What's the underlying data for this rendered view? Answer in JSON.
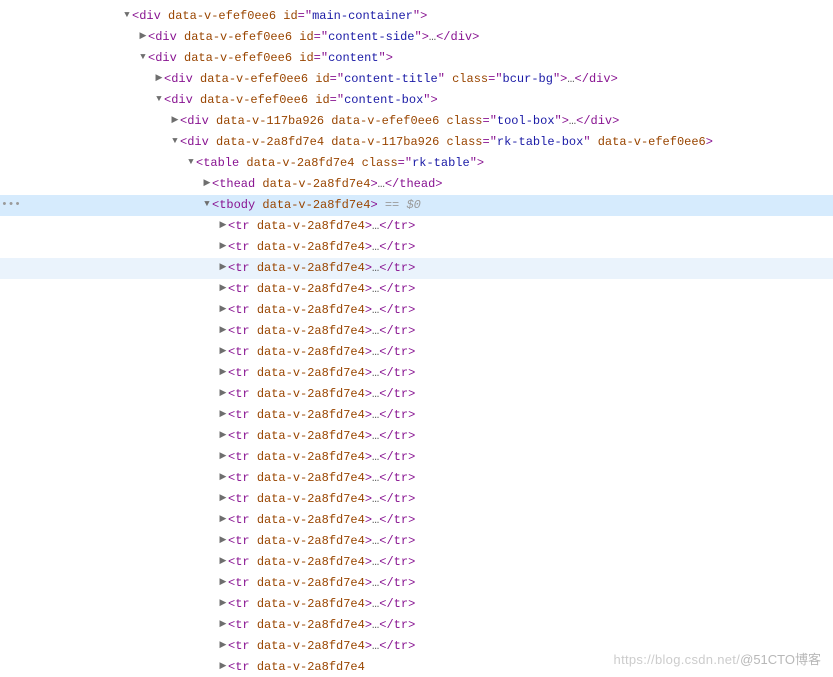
{
  "indentStep": 16,
  "baseIndent": 100,
  "selectedIndex": 8,
  "hoveredIndex": 11,
  "gutterMarkIndex": 8,
  "gutterMark": "•••",
  "console_ref": " == $0",
  "watermark": {
    "left": "https://blog.csdn.net/",
    "right": "@51CTO博客"
  },
  "nodes": [
    {
      "depth": 0,
      "arrow": "down",
      "kind": "open",
      "tag": "div",
      "attrs": [
        [
          "data-v-efef0ee6",
          null
        ],
        [
          "id",
          "main-container"
        ]
      ]
    },
    {
      "depth": 1,
      "arrow": "right",
      "kind": "collapsed",
      "tag": "div",
      "attrs": [
        [
          "data-v-efef0ee6",
          null
        ],
        [
          "id",
          "content-side"
        ]
      ]
    },
    {
      "depth": 1,
      "arrow": "down",
      "kind": "open",
      "tag": "div",
      "attrs": [
        [
          "data-v-efef0ee6",
          null
        ],
        [
          "id",
          "content"
        ]
      ]
    },
    {
      "depth": 2,
      "arrow": "right",
      "kind": "collapsed",
      "tag": "div",
      "attrs": [
        [
          "data-v-efef0ee6",
          null
        ],
        [
          "id",
          "content-title"
        ],
        [
          "class",
          "bcur-bg"
        ]
      ]
    },
    {
      "depth": 2,
      "arrow": "down",
      "kind": "open",
      "tag": "div",
      "attrs": [
        [
          "data-v-efef0ee6",
          null
        ],
        [
          "id",
          "content-box"
        ]
      ]
    },
    {
      "depth": 3,
      "arrow": "right",
      "kind": "collapsed",
      "tag": "div",
      "attrs": [
        [
          "data-v-117ba926",
          null
        ],
        [
          "data-v-efef0ee6",
          null
        ],
        [
          "class",
          "tool-box"
        ]
      ]
    },
    {
      "depth": 3,
      "arrow": "down",
      "kind": "open",
      "tag": "div",
      "attrs": [
        [
          "data-v-2a8fd7e4",
          null
        ],
        [
          "data-v-117ba926",
          null
        ],
        [
          "class",
          "rk-table-box"
        ],
        [
          "data-v-efef0ee6",
          null
        ]
      ]
    },
    {
      "depth": 4,
      "arrow": "down",
      "kind": "open",
      "tag": "table",
      "attrs": [
        [
          "data-v-2a8fd7e4",
          null
        ],
        [
          "class",
          "rk-table"
        ]
      ]
    },
    {
      "depth": 5,
      "arrow": "right",
      "kind": "collapsed",
      "tag": "thead",
      "attrs": [
        [
          "data-v-2a8fd7e4",
          null
        ]
      ]
    },
    {
      "depth": 5,
      "arrow": "down",
      "kind": "open",
      "tag": "tbody",
      "attrs": [
        [
          "data-v-2a8fd7e4",
          null
        ]
      ],
      "consoleRef": true
    },
    {
      "depth": 6,
      "arrow": "right",
      "kind": "collapsed",
      "tag": "tr",
      "attrs": [
        [
          "data-v-2a8fd7e4",
          null
        ]
      ]
    },
    {
      "depth": 6,
      "arrow": "right",
      "kind": "collapsed",
      "tag": "tr",
      "attrs": [
        [
          "data-v-2a8fd7e4",
          null
        ]
      ]
    },
    {
      "depth": 6,
      "arrow": "right",
      "kind": "collapsed",
      "tag": "tr",
      "attrs": [
        [
          "data-v-2a8fd7e4",
          null
        ]
      ]
    },
    {
      "depth": 6,
      "arrow": "right",
      "kind": "collapsed",
      "tag": "tr",
      "attrs": [
        [
          "data-v-2a8fd7e4",
          null
        ]
      ]
    },
    {
      "depth": 6,
      "arrow": "right",
      "kind": "collapsed",
      "tag": "tr",
      "attrs": [
        [
          "data-v-2a8fd7e4",
          null
        ]
      ]
    },
    {
      "depth": 6,
      "arrow": "right",
      "kind": "collapsed",
      "tag": "tr",
      "attrs": [
        [
          "data-v-2a8fd7e4",
          null
        ]
      ]
    },
    {
      "depth": 6,
      "arrow": "right",
      "kind": "collapsed",
      "tag": "tr",
      "attrs": [
        [
          "data-v-2a8fd7e4",
          null
        ]
      ]
    },
    {
      "depth": 6,
      "arrow": "right",
      "kind": "collapsed",
      "tag": "tr",
      "attrs": [
        [
          "data-v-2a8fd7e4",
          null
        ]
      ]
    },
    {
      "depth": 6,
      "arrow": "right",
      "kind": "collapsed",
      "tag": "tr",
      "attrs": [
        [
          "data-v-2a8fd7e4",
          null
        ]
      ]
    },
    {
      "depth": 6,
      "arrow": "right",
      "kind": "collapsed",
      "tag": "tr",
      "attrs": [
        [
          "data-v-2a8fd7e4",
          null
        ]
      ]
    },
    {
      "depth": 6,
      "arrow": "right",
      "kind": "collapsed",
      "tag": "tr",
      "attrs": [
        [
          "data-v-2a8fd7e4",
          null
        ]
      ]
    },
    {
      "depth": 6,
      "arrow": "right",
      "kind": "collapsed",
      "tag": "tr",
      "attrs": [
        [
          "data-v-2a8fd7e4",
          null
        ]
      ]
    },
    {
      "depth": 6,
      "arrow": "right",
      "kind": "collapsed",
      "tag": "tr",
      "attrs": [
        [
          "data-v-2a8fd7e4",
          null
        ]
      ]
    },
    {
      "depth": 6,
      "arrow": "right",
      "kind": "collapsed",
      "tag": "tr",
      "attrs": [
        [
          "data-v-2a8fd7e4",
          null
        ]
      ]
    },
    {
      "depth": 6,
      "arrow": "right",
      "kind": "collapsed",
      "tag": "tr",
      "attrs": [
        [
          "data-v-2a8fd7e4",
          null
        ]
      ]
    },
    {
      "depth": 6,
      "arrow": "right",
      "kind": "collapsed",
      "tag": "tr",
      "attrs": [
        [
          "data-v-2a8fd7e4",
          null
        ]
      ]
    },
    {
      "depth": 6,
      "arrow": "right",
      "kind": "collapsed",
      "tag": "tr",
      "attrs": [
        [
          "data-v-2a8fd7e4",
          null
        ]
      ]
    },
    {
      "depth": 6,
      "arrow": "right",
      "kind": "collapsed",
      "tag": "tr",
      "attrs": [
        [
          "data-v-2a8fd7e4",
          null
        ]
      ]
    },
    {
      "depth": 6,
      "arrow": "right",
      "kind": "collapsed",
      "tag": "tr",
      "attrs": [
        [
          "data-v-2a8fd7e4",
          null
        ]
      ]
    },
    {
      "depth": 6,
      "arrow": "right",
      "kind": "collapsed",
      "tag": "tr",
      "attrs": [
        [
          "data-v-2a8fd7e4",
          null
        ]
      ]
    },
    {
      "depth": 6,
      "arrow": "right",
      "kind": "collapsed",
      "tag": "tr",
      "attrs": [
        [
          "data-v-2a8fd7e4",
          null
        ]
      ]
    },
    {
      "depth": 6,
      "arrow": "right",
      "kind": "partial",
      "tag": "tr",
      "attrs": [
        [
          "data-v-2a8fd7e4",
          null
        ]
      ]
    }
  ]
}
